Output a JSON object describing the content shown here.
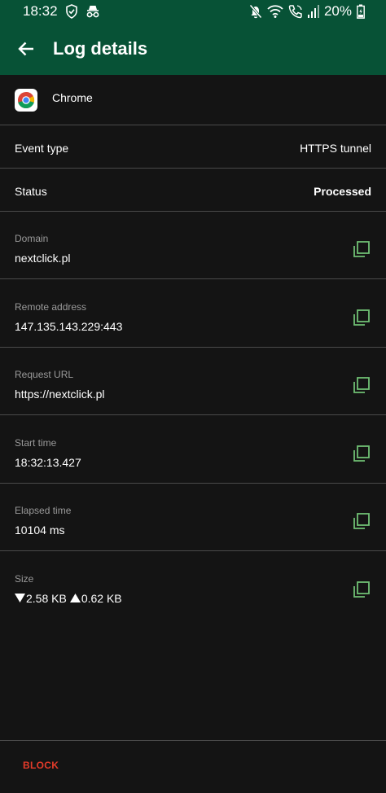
{
  "status_bar": {
    "time": "18:32",
    "battery": "20%",
    "icons_left": [
      "vpn-shield-icon",
      "incognito-icon"
    ],
    "icons_right": [
      "mute-icon",
      "wifi-icon",
      "call-icon",
      "signal-icon",
      "battery-icon"
    ]
  },
  "app_bar": {
    "title": "Log details",
    "color": "#075236"
  },
  "app": {
    "name": "Chrome",
    "icon": "chrome-logo-icon"
  },
  "rows": {
    "event_type": {
      "label": "Event type",
      "value": "HTTPS tunnel"
    },
    "status": {
      "label": "Status",
      "value": "Processed"
    }
  },
  "details": {
    "domain": {
      "label": "Domain",
      "value": "nextclick.pl"
    },
    "remote_address": {
      "label": "Remote address",
      "value": "147.135.143.229:443"
    },
    "request_url": {
      "label": "Request URL",
      "value": "https://nextclick.pl"
    },
    "start_time": {
      "label": "Start time",
      "value": "18:32:13.427"
    },
    "elapsed_time": {
      "label": "Elapsed time",
      "value": "10104 ms"
    },
    "size": {
      "label": "Size",
      "download": "2.58 KB",
      "upload": "0.62 KB"
    }
  },
  "actions": {
    "block_label": "BLOCK",
    "block_color": "#e53b2a"
  },
  "colors": {
    "copy_icon": "#6fbf73",
    "background": "#141414"
  }
}
